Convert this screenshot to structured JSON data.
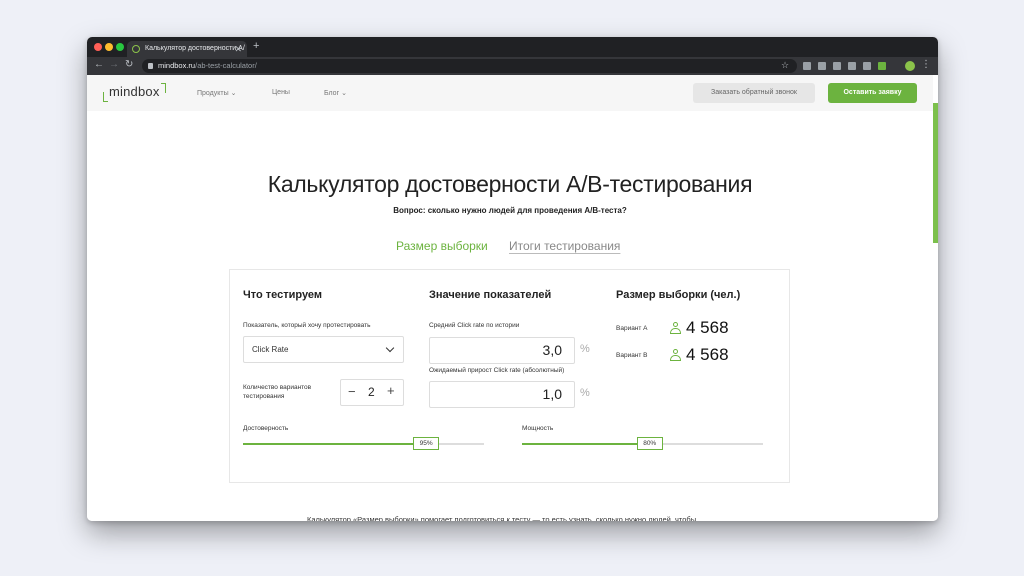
{
  "browser": {
    "tab_title": "Калькулятор достоверности А/",
    "url_host": "mindbox.ru",
    "url_path": "/ab-test-calculator/"
  },
  "header": {
    "logo": "mindbox",
    "nav": [
      "Продукты",
      "Цены",
      "Блог"
    ],
    "callback_button": "Заказать обратный звонок",
    "order_button": "Оставить заявку"
  },
  "page": {
    "title": "Калькулятор достоверности А/В-тестирования",
    "subtitle": "Вопрос: сколько нужно людей для проведения А/В-теста?",
    "tabs": [
      "Размер выборки",
      "Итоги тестирования"
    ]
  },
  "calculator": {
    "col1_title": "Что тестируем",
    "metric_label": "Показатель, который хочу протестировать",
    "metric_value": "Click Rate",
    "variants_label_line1": "Количество вариантов",
    "variants_label_line2": "тестирования",
    "variants_count": "2",
    "col2_title": "Значение показателей",
    "avg_label": "Средний Click rate по истории",
    "avg_value": "3,0",
    "growth_label": "Ожидаемый прирост Click rate (абсолютный)",
    "growth_value": "1,0",
    "unit": "%",
    "col3_title": "Размер выборки (чел.)",
    "variant_a_label": "Вариант А",
    "variant_a_value": "4 568",
    "variant_b_label": "Вариант В",
    "variant_b_value": "4 568",
    "confidence_label": "Достоверность",
    "confidence_value": "95%",
    "confidence_fraction": 0.76,
    "power_label": "Мощность",
    "power_value": "80%",
    "power_fraction": 0.53
  },
  "description": "Калькулятор «Размер выборки» помогает подготовиться к тесту — то есть узнать, сколько нужно людей, чтобы результаты были достоверными.",
  "colors": {
    "accent": "#6cb33f",
    "chrome_dark": "#202124"
  }
}
